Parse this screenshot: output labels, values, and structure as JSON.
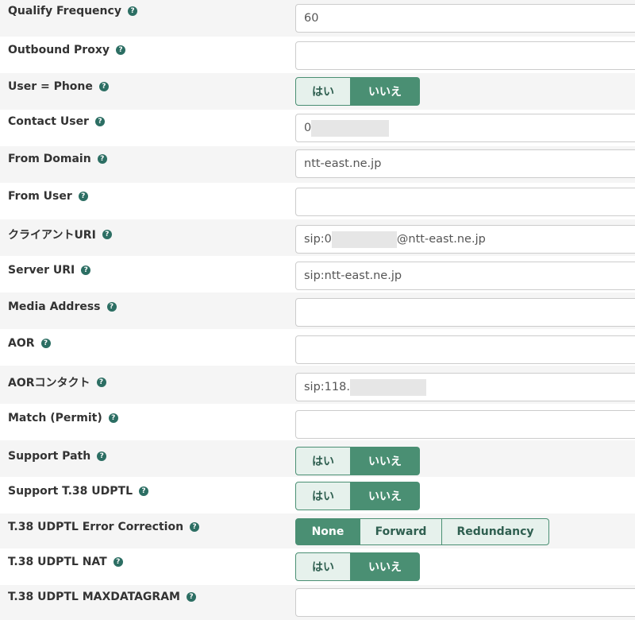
{
  "yes_label": "はい",
  "no_label": "いいえ",
  "help_glyph": "?",
  "fields": {
    "qualify_frequency": {
      "label": "Qualify Frequency",
      "value": "60"
    },
    "outbound_proxy": {
      "label": "Outbound Proxy",
      "value": ""
    },
    "user_eq_phone": {
      "label": "User = Phone",
      "selected": "いいえ"
    },
    "contact_user": {
      "label": "Contact User",
      "value": "0"
    },
    "from_domain": {
      "label": "From Domain",
      "value": "ntt-east.ne.jp"
    },
    "from_user": {
      "label": "From User",
      "value": ""
    },
    "client_uri": {
      "label": "クライアントURI",
      "value_prefix": "sip:0",
      "value_suffix": "@ntt-east.ne.jp"
    },
    "server_uri": {
      "label": "Server URI",
      "value": "sip:ntt-east.ne.jp"
    },
    "media_address": {
      "label": "Media Address",
      "value": ""
    },
    "aor": {
      "label": "AOR",
      "value": ""
    },
    "aor_contact": {
      "label": "AORコンタクト",
      "value": "sip:118."
    },
    "match_permit": {
      "label": "Match (Permit)",
      "value": ""
    },
    "support_path": {
      "label": "Support Path",
      "selected": "いいえ"
    },
    "support_t38": {
      "label": "Support T.38 UDPTL",
      "selected": "いいえ"
    },
    "t38_error_correction": {
      "label": "T.38 UDPTL Error Correction",
      "options": [
        "None",
        "Forward",
        "Redundancy"
      ],
      "selected": "None"
    },
    "t38_nat": {
      "label": "T.38 UDPTL NAT",
      "selected": "いいえ"
    },
    "t38_maxdatagram": {
      "label": "T.38 UDPTL MAXDATAGRAM",
      "value": ""
    }
  },
  "colors": {
    "accent": "#4a8f73",
    "accent_light": "#e6f1ec",
    "help_icon": "#2c6e63",
    "row_alt": "#f5f5f5",
    "masked": "#e6e6e6"
  }
}
